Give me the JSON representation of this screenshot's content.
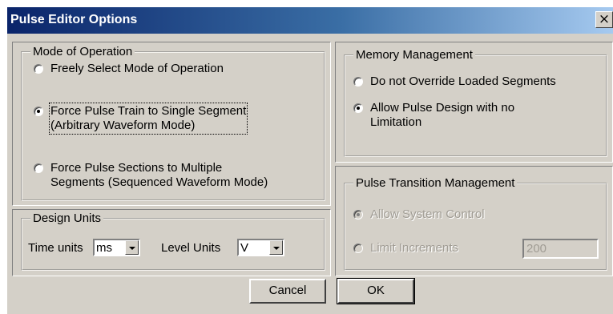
{
  "dialog": {
    "title": "Pulse Editor Options",
    "close_icon": "x-icon",
    "close_glyph": "×"
  },
  "mode_of_operation": {
    "legend": "Mode of Operation",
    "options": [
      {
        "label_lines": [
          "Freely Select Mode of Operation"
        ],
        "checked": false
      },
      {
        "label_lines": [
          "Force Pulse Train to Single Segment",
          "(Arbitrary Waveform Mode)"
        ],
        "checked": true
      },
      {
        "label_lines": [
          "Force Pulse Sections to Multiple",
          "Segments (Sequenced  Waveform Mode)"
        ],
        "checked": false
      }
    ]
  },
  "design_units": {
    "legend": "Design Units",
    "time_label": "Time units",
    "time_value": "ms",
    "level_label": "Level Units",
    "level_value": "V"
  },
  "memory_management": {
    "legend": "Memory Management",
    "options": [
      {
        "label_lines": [
          "Do not Override Loaded Segments"
        ],
        "checked": false
      },
      {
        "label_lines": [
          "Allow Pulse Design with no",
          "Limitation"
        ],
        "checked": true
      }
    ]
  },
  "pulse_transition": {
    "legend": "Pulse Transition Management",
    "allow_system_control": "Allow System Control",
    "limit_increments": "Limit Increments",
    "increment_value": "200"
  },
  "buttons": {
    "cancel": "Cancel",
    "ok": "OK"
  }
}
